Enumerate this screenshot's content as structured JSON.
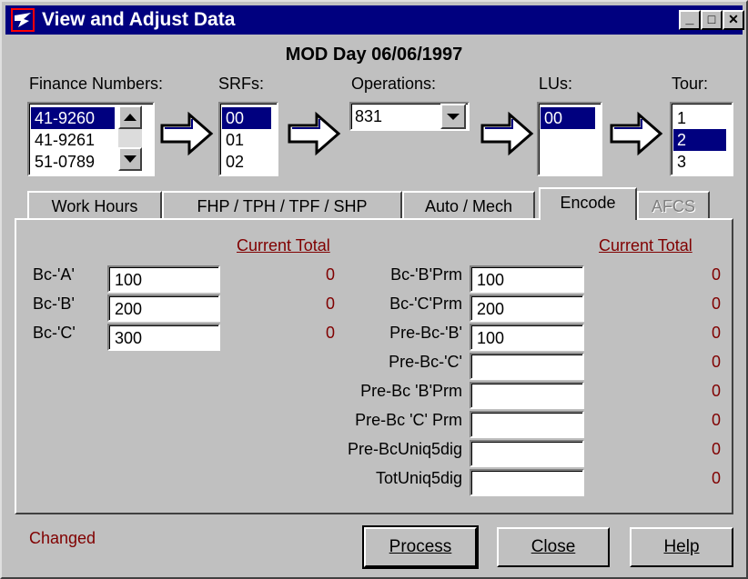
{
  "window": {
    "title": "View and Adjust Data",
    "heading": "MOD Day 06/06/1997"
  },
  "titlebar": {
    "minimize": "_",
    "maximize": "□",
    "close": "✕"
  },
  "selectors": {
    "finance_label": "Finance Numbers:",
    "finance_items": [
      "41-9260",
      "41-9261",
      "51-0789"
    ],
    "finance_selected": 0,
    "srfs_label": "SRFs:",
    "srfs_items": [
      "00",
      "01",
      "02"
    ],
    "srfs_selected": 0,
    "operations_label": "Operations:",
    "operations_value": "831",
    "lus_label": "LUs:",
    "lus_items": [
      "00"
    ],
    "lus_selected": 0,
    "tour_label": "Tour:",
    "tour_items": [
      "1",
      "2",
      "3"
    ],
    "tour_selected": 1
  },
  "tabs": [
    {
      "label": "Work Hours",
      "active": false,
      "disabled": false
    },
    {
      "label": "FHP / TPH / TPF / SHP",
      "active": false,
      "disabled": false
    },
    {
      "label": "Auto / Mech",
      "active": false,
      "disabled": false
    },
    {
      "label": "Encode",
      "active": true,
      "disabled": false
    },
    {
      "label": "AFCS",
      "active": false,
      "disabled": true
    }
  ],
  "panel": {
    "current_total_left": "Current Total",
    "current_total_right": "Current Total",
    "left_rows": [
      {
        "label": "Bc-'A'",
        "value": "100",
        "total": "0"
      },
      {
        "label": "Bc-'B'",
        "value": "200",
        "total": "0"
      },
      {
        "label": "Bc-'C'",
        "value": "300",
        "total": "0"
      }
    ],
    "right_rows": [
      {
        "label": "Bc-'B'Prm",
        "value": "100",
        "total": "0"
      },
      {
        "label": "Bc-'C'Prm",
        "value": "200",
        "total": "0"
      },
      {
        "label": "Pre-Bc-'B'",
        "value": "100",
        "total": "0"
      },
      {
        "label": "Pre-Bc-'C'",
        "value": "",
        "total": "0"
      },
      {
        "label": "Pre-Bc 'B'Prm",
        "value": "",
        "total": "0"
      },
      {
        "label": "Pre-Bc 'C' Prm",
        "value": "",
        "total": "0"
      },
      {
        "label": "Pre-BcUniq5dig",
        "value": "",
        "total": "0"
      },
      {
        "label": "TotUniq5dig",
        "value": "",
        "total": "0"
      }
    ]
  },
  "footer": {
    "status": "Changed",
    "process": "Process",
    "close": "Close",
    "help": "Help"
  },
  "colors": {
    "title_bg": "#00007f",
    "face": "#c0c0c0",
    "selection": "#00007f",
    "accent_red": "#800000"
  }
}
